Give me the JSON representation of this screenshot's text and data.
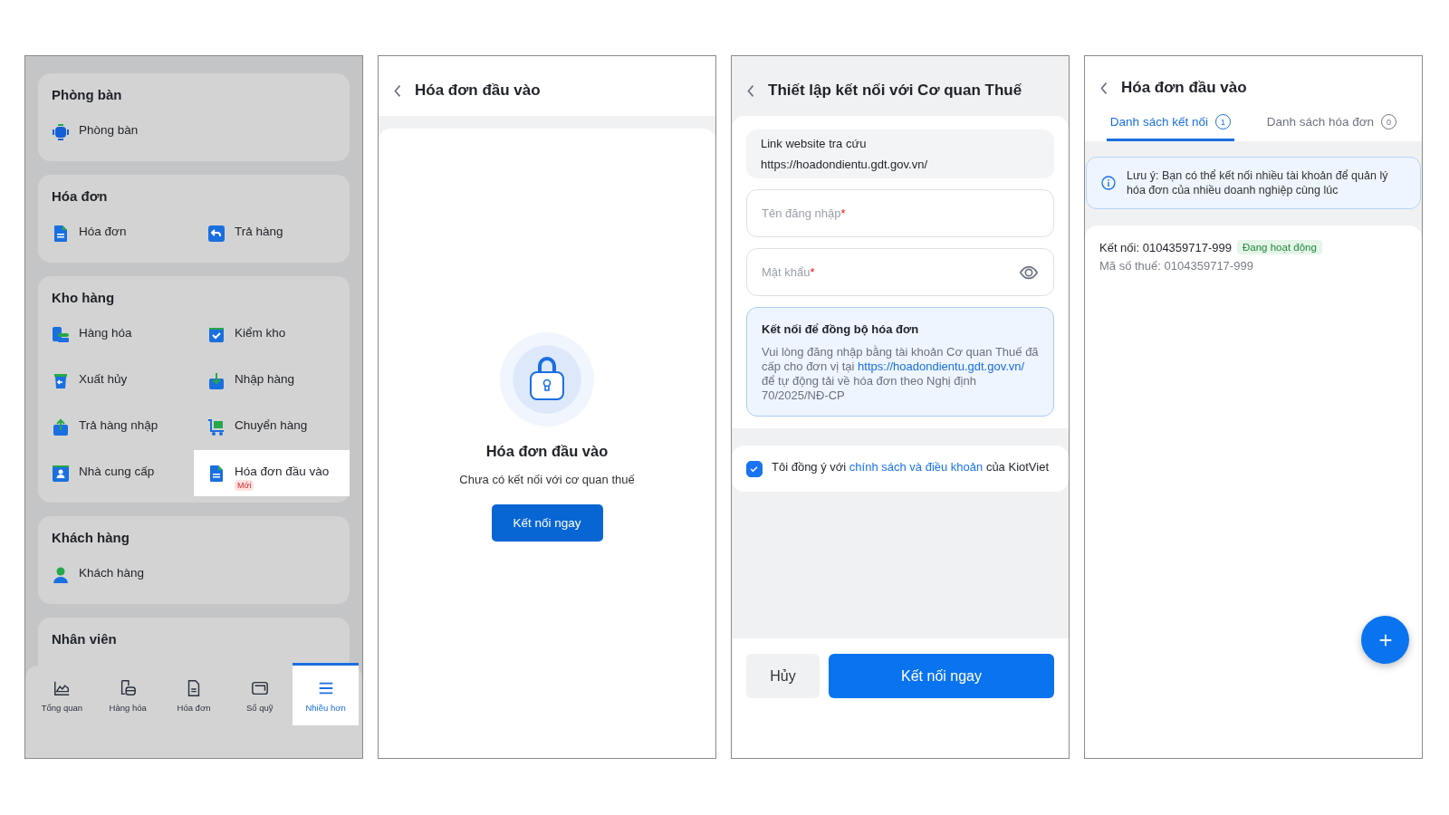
{
  "menu_screen": {
    "sections": [
      {
        "title": "Phòng bàn",
        "items": [
          {
            "label": "Phòng bàn",
            "selected": false
          }
        ]
      },
      {
        "title": "Hóa đơn",
        "items": [
          {
            "label": "Hóa đơn",
            "selected": false
          },
          {
            "label": "Trả hàng",
            "selected": false
          }
        ]
      },
      {
        "title": "Kho hàng",
        "items": [
          {
            "label": "Hàng hóa",
            "selected": false
          },
          {
            "label": "Kiểm kho",
            "selected": false
          },
          {
            "label": "Xuất hủy",
            "selected": false
          },
          {
            "label": "Nhập hàng",
            "selected": false
          },
          {
            "label": "Trả hàng nhập",
            "selected": false
          },
          {
            "label": "Chuyển hàng",
            "selected": false
          },
          {
            "label": "Nhà cung cấp",
            "selected": false
          },
          {
            "label": "Hóa đơn đầu vào",
            "selected": true,
            "badge": "Mới"
          }
        ]
      },
      {
        "title": "Khách hàng",
        "items": [
          {
            "label": "Khách hàng",
            "selected": false
          }
        ]
      },
      {
        "title": "Nhân viên"
      }
    ],
    "bottom_nav": [
      {
        "label": "Tổng quan",
        "selected": false
      },
      {
        "label": "Hàng hóa",
        "selected": false
      },
      {
        "label": "Hóa đơn",
        "selected": false
      },
      {
        "label": "Sổ quỹ",
        "selected": false
      },
      {
        "label": "Nhiều hơn",
        "selected": true
      }
    ]
  },
  "empty_screen": {
    "title": "Hóa đơn đầu vào",
    "heading": "Hóa đơn đầu vào",
    "message": "Chưa có kết nối với cơ quan thuế",
    "button": "Kết nối ngay"
  },
  "setup_screen": {
    "title": "Thiết lập kết nối với Cơ quan Thuế",
    "link_label": "Link website tra cứu",
    "link_value": "https://hoadondientu.gdt.gov.vn/",
    "username": {
      "placeholder": "Tên đăng nhập",
      "required_mark": "*"
    },
    "password": {
      "placeholder": "Mật khẩu",
      "required_mark": "*"
    },
    "info": {
      "title": "Kết nối để đồng bộ hóa đơn",
      "before": "Vui lòng đăng nhập bằng tài khoản Cơ quan Thuế đã cấp cho đơn vị tại",
      "link": "https://hoadondientu.gdt.gov.vn/",
      "after": "để tự động tải về hóa đơn theo Nghị định 70/2025/NĐ-CP"
    },
    "consent": {
      "checked": true,
      "before": "Tôi đồng ý với",
      "link": "chính sách và điều khoản",
      "after": "của KiotViet"
    },
    "cancel_button": "Hủy",
    "confirm_button": "Kết nối ngay"
  },
  "list_screen": {
    "title": "Hóa đơn đầu vào",
    "tabs": [
      {
        "label": "Danh sách kết nối",
        "count": "1",
        "selected": true
      },
      {
        "label": "Danh sách hóa đơn",
        "count": "0",
        "selected": false
      }
    ],
    "note": "Lưu ý: Bạn có thể kết nối nhiều tài khoản để quản lý hóa đơn của nhiều doanh nghiệp cùng lúc",
    "connections": [
      {
        "label": "Kết nối: 0104359717-999",
        "status": "Đang hoạt động",
        "tax_id": "Mã số thuế: 0104359717-999"
      }
    ]
  }
}
